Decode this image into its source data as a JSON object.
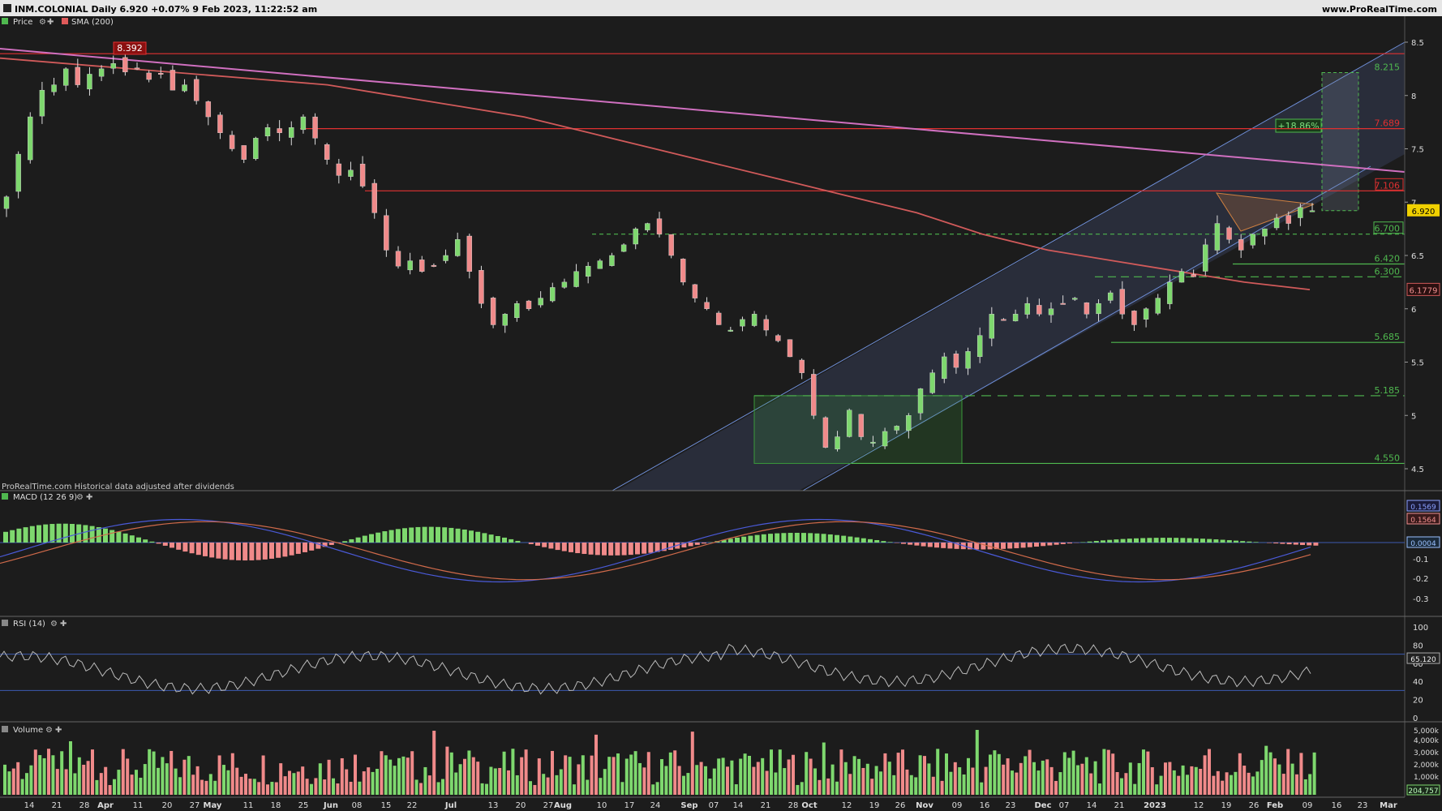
{
  "header": {
    "title": "INM.COLONIAL  Daily 6.920 +0.07% 9 Feb 2023, 11:22:52 am",
    "brand": "www.ProRealTime.com"
  },
  "price_panel": {
    "labels": [
      "Price",
      "SMA (200)"
    ],
    "footer_note": "ProRealTime.com  Historical data adjusted after dividends",
    "y_ticks": [
      "8.5",
      "8",
      "7.5",
      "7",
      "6.5",
      "6",
      "5.5",
      "5",
      "4.5"
    ],
    "last_price_tag": "6.920",
    "sma_tag": "6.1779",
    "percent_box": "+18.86%",
    "high_tag": "8.392",
    "level_labels": [
      {
        "value": "8.215",
        "color": "#4fb84f"
      },
      {
        "value": "7.689",
        "color": "#e03030"
      },
      {
        "value": "7.106",
        "color": "#e03030"
      },
      {
        "value": "6.700",
        "color": "#4fb84f"
      },
      {
        "value": "6.420",
        "color": "#4fb84f"
      },
      {
        "value": "6.300",
        "color": "#4fb84f"
      },
      {
        "value": "5.685",
        "color": "#4fb84f"
      },
      {
        "value": "5.185",
        "color": "#4fb84f"
      },
      {
        "value": "4.550",
        "color": "#4fb84f"
      }
    ]
  },
  "macd_panel": {
    "label": "MACD (12 26 9)",
    "y_ticks": [
      "-0.1",
      "-0.2",
      "-0.3"
    ],
    "tags": [
      "0.1569",
      "0.1564",
      "0.0004"
    ]
  },
  "rsi_panel": {
    "label": "RSI (14)",
    "y_ticks": [
      "100",
      "80",
      "60",
      "40",
      "20",
      "0"
    ],
    "tag": "65.120"
  },
  "volume_panel": {
    "label": "Volume",
    "y_ticks": [
      "5,000k",
      "4,000k",
      "3,000k",
      "2,000k",
      "1,000k"
    ],
    "tag": "204,757"
  },
  "x_axis": {
    "labels": [
      "14",
      "21",
      "28",
      "Apr",
      "11",
      "20",
      "27",
      "May",
      "11",
      "18",
      "25",
      "Jun",
      "08",
      "15",
      "22",
      "Jul",
      "13",
      "20",
      "27",
      "Aug",
      "10",
      "17",
      "24",
      "Sep",
      "07",
      "14",
      "21",
      "28",
      "Oct",
      "12",
      "19",
      "26",
      "Nov",
      "09",
      "16",
      "23",
      "Dec",
      "07",
      "14",
      "21",
      "2023",
      "12",
      "19",
      "26",
      "Feb",
      "09",
      "16",
      "23",
      "Mar"
    ],
    "bold_labels": [
      "Apr",
      "May",
      "Jun",
      "Jul",
      "Aug",
      "Sep",
      "Oct",
      "Nov",
      "Dec",
      "2023",
      "Feb",
      "Mar"
    ]
  },
  "chart_data": {
    "type": "candlestick",
    "title": "INM.COLONIAL Daily",
    "ylim": [
      4.4,
      8.6
    ],
    "price_series": [
      7.05,
      7.45,
      7.8,
      8.05,
      8.1,
      8.25,
      8.1,
      8.2,
      8.25,
      8.3,
      8.22,
      8.25,
      8.15,
      8.2,
      8.05,
      8.1,
      7.95,
      7.8,
      7.65,
      7.5,
      7.4,
      7.6,
      7.7,
      7.65,
      7.7,
      7.8,
      7.6,
      7.4,
      7.25,
      7.3,
      7.15,
      6.9,
      6.55,
      6.4,
      6.45,
      6.35,
      6.4,
      6.5,
      6.65,
      6.35,
      6.05,
      5.85,
      5.95,
      6.05,
      6.0,
      6.1,
      6.2,
      6.25,
      6.35,
      6.4,
      6.45,
      6.5,
      6.6,
      6.75,
      6.8,
      6.7,
      6.5,
      6.25,
      6.1,
      6.0,
      5.85,
      5.8,
      5.9,
      5.95,
      5.8,
      5.7,
      5.55,
      5.4,
      5.0,
      4.7,
      4.8,
      5.05,
      4.8,
      4.75,
      4.85,
      4.9,
      5.0,
      5.25,
      5.4,
      5.55,
      5.45,
      5.6,
      5.75,
      5.95,
      5.9,
      5.95,
      6.05,
      5.95,
      6.0,
      6.05,
      6.1,
      5.95,
      6.05,
      6.15,
      5.95,
      5.85,
      6.0,
      6.1,
      6.25,
      6.35,
      6.3,
      6.6,
      6.8,
      6.65,
      6.55,
      6.7,
      6.75,
      6.85,
      6.8,
      6.95,
      6.92
    ],
    "sma200_series": [
      8.35,
      8.3,
      8.25,
      8.2,
      8.15,
      8.1,
      8.0,
      7.9,
      7.8,
      7.65,
      7.5,
      7.35,
      7.2,
      7.05,
      6.9,
      6.7,
      6.55,
      6.45,
      6.35,
      6.25,
      6.18
    ],
    "levels": [
      8.392,
      8.215,
      7.689,
      7.106,
      6.7,
      6.42,
      6.3,
      5.685,
      5.185,
      4.55
    ],
    "last": 6.92,
    "change_pct": 0.07,
    "date": "9 Feb 2023"
  }
}
